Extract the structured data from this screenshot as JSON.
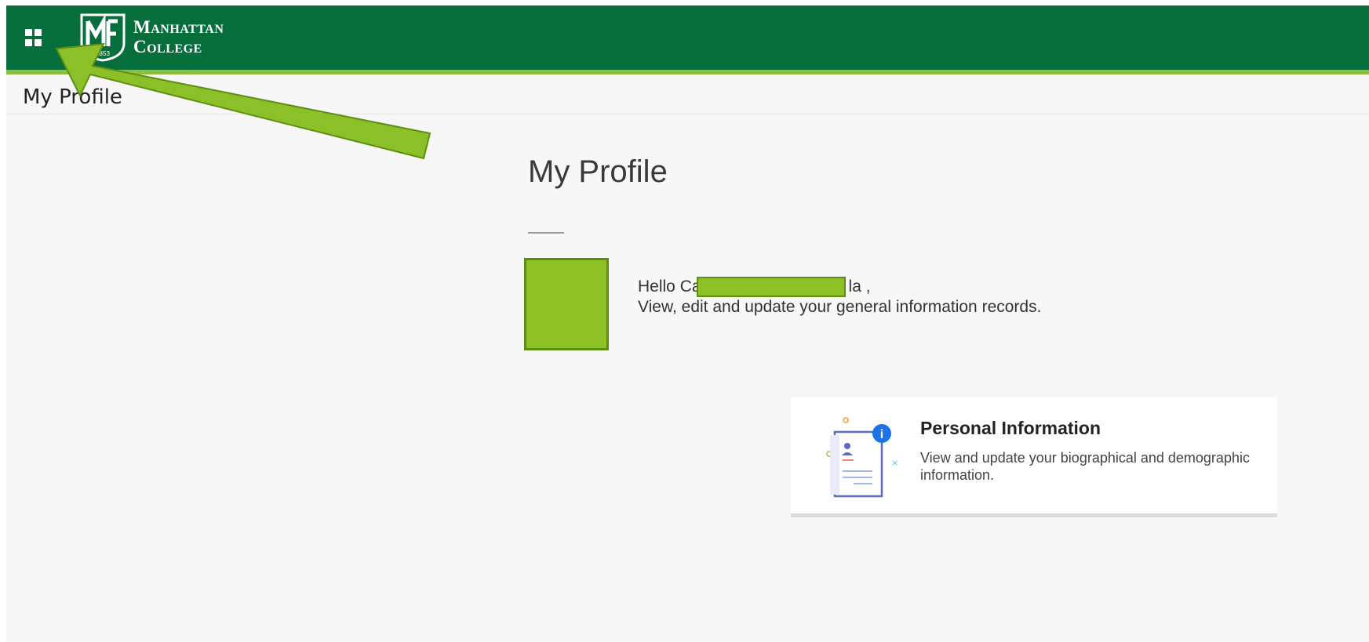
{
  "header": {
    "apps_button": "grid-apps-icon",
    "logo": {
      "line1": "Manhattan",
      "line2": "College",
      "mark_year": "1853"
    },
    "brand_color": "#066e3a",
    "accent_color": "#8cbf3f"
  },
  "page_bar": {
    "title": "My Profile"
  },
  "main": {
    "title": "My Profile",
    "greeting": {
      "prefix": "Hello Ca",
      "suffix": "la ,",
      "subtitle": "View, edit and update your general information records."
    }
  },
  "card": {
    "title": "Personal Information",
    "description": "View and update your biographical and demographic information.",
    "icon": "profile-document-info-icon"
  },
  "annotation": {
    "type": "arrow",
    "color": "#8cc028"
  }
}
